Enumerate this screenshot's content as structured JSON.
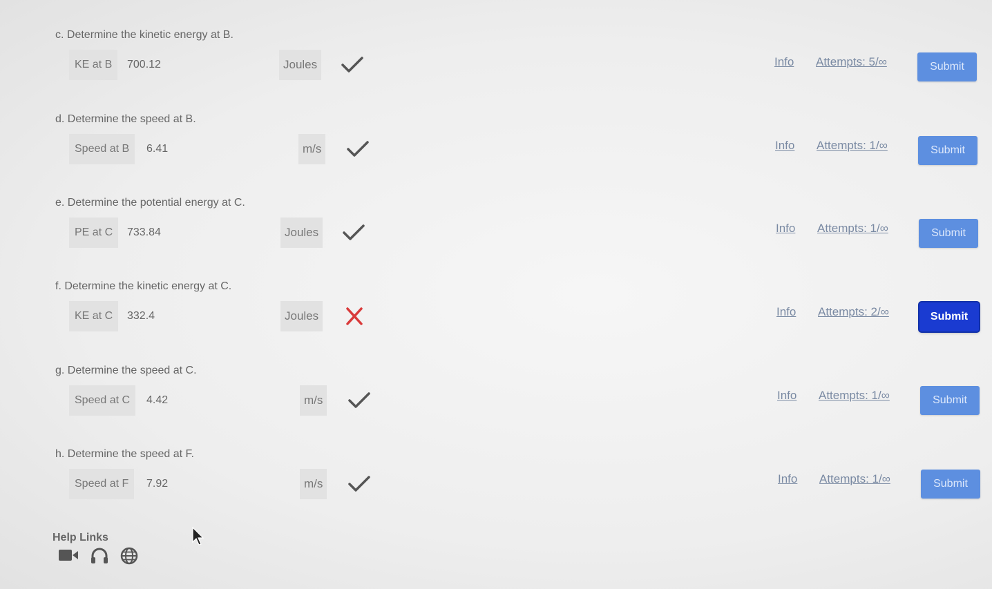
{
  "questions": [
    {
      "prompt": "c. Determine the kinetic energy at B.",
      "label": "KE at B",
      "value": "700.12",
      "unit": "Joules",
      "status": "correct",
      "info": "Info",
      "attempts": "Attempts: 5/∞",
      "submit": "Submit"
    },
    {
      "prompt": "d. Determine the speed at B.",
      "label": "Speed at B",
      "value": "6.41",
      "unit": "m/s",
      "status": "correct",
      "info": "Info",
      "attempts": "Attempts: 1/∞",
      "submit": "Submit"
    },
    {
      "prompt": "e. Determine the potential energy at C.",
      "label": "PE at C",
      "value": "733.84",
      "unit": "Joules",
      "status": "correct",
      "info": "Info",
      "attempts": "Attempts: 1/∞",
      "submit": "Submit"
    },
    {
      "prompt": "f. Determine the kinetic energy at C.",
      "label": "KE at C",
      "value": "332.4",
      "unit": "Joules",
      "status": "incorrect",
      "info": "Info",
      "attempts": "Attempts: 2/∞",
      "submit": "Submit"
    },
    {
      "prompt": "g. Determine the speed at C.",
      "label": "Speed at C",
      "value": "4.42",
      "unit": "m/s",
      "status": "correct",
      "info": "Info",
      "attempts": "Attempts: 1/∞",
      "submit": "Submit"
    },
    {
      "prompt": "h. Determine the speed at F.",
      "label": "Speed at F",
      "value": "7.92",
      "unit": "m/s",
      "status": "correct",
      "info": "Info",
      "attempts": "Attempts: 1/∞",
      "submit": "Submit"
    }
  ],
  "help": {
    "title": "Help Links",
    "icons": [
      "video-icon",
      "headset-icon",
      "globe-icon"
    ]
  },
  "colors": {
    "submit": "#5d8fe0",
    "submit_active": "#1a3bd1",
    "correct": "#555555",
    "incorrect": "#d93a3a",
    "link": "#7a8aa3"
  }
}
